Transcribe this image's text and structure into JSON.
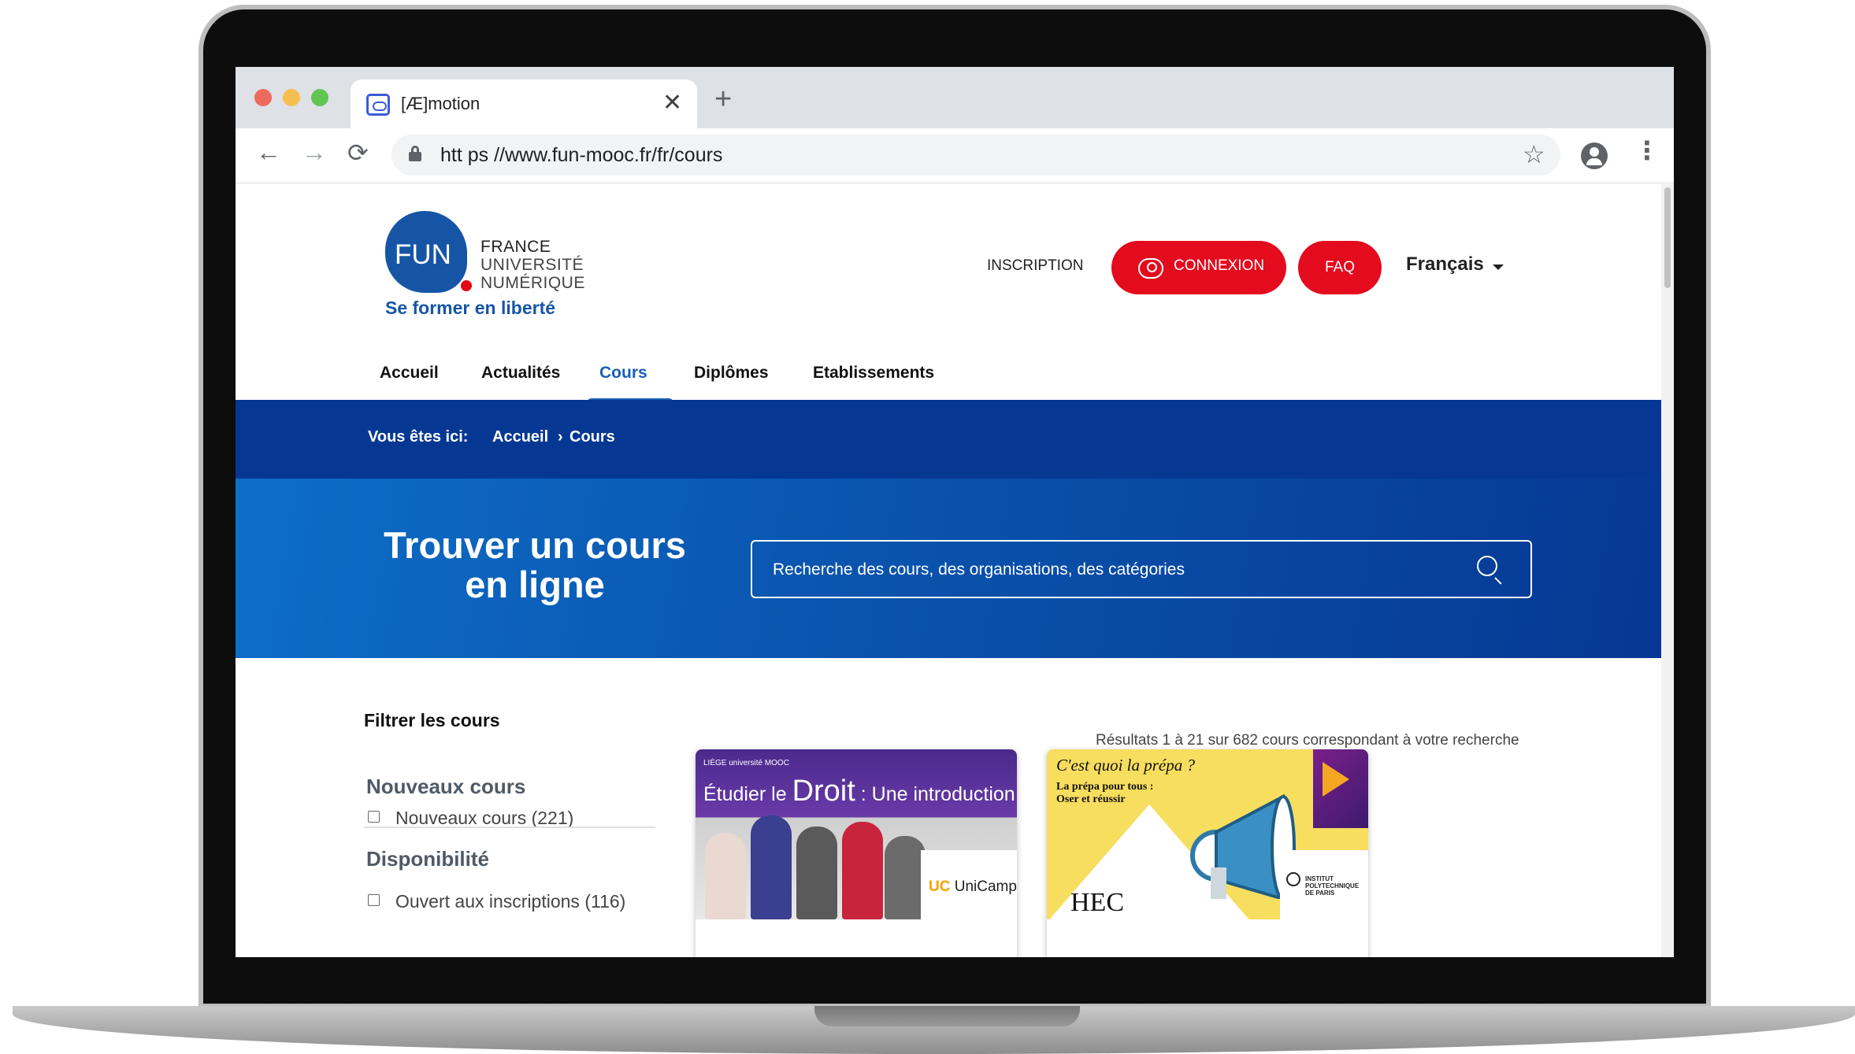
{
  "browser": {
    "tab_title": "[Æ]motion",
    "tab_close": "✕",
    "new_tab": "+",
    "back": "←",
    "forward": "→",
    "reload": "⟳",
    "url": "htt ps //www.fun-mooc.fr/fr/cours",
    "star": "☆",
    "menu": "⋮",
    "icons": [
      "aemotion-favicon",
      "lock-icon",
      "bookmark-star-icon",
      "account-icon",
      "menu-dots-icon"
    ]
  },
  "site": {
    "logo": {
      "fun": "FUN",
      "line1": "FRANCE",
      "line2": "UNIVERSITÉ",
      "line3": "NUMÉRIQUE",
      "tagline": "Se former en liberté"
    },
    "header": {
      "inscription": "INSCRIPTION",
      "connexion": "CONNEXION",
      "faq": "FAQ",
      "language": "Français"
    },
    "nav": {
      "items": [
        "Accueil",
        "Actualités",
        "Cours",
        "Diplômes",
        "Etablissements"
      ],
      "active": "Cours"
    },
    "breadcrumb": {
      "prefix": "Vous êtes ici:",
      "home": "Accueil",
      "sep": "›",
      "current": "Cours"
    },
    "hero": {
      "title_line1": "Trouver un cours",
      "title_line2": "en ligne",
      "search_placeholder": "Recherche des cours, des organisations, des catégories"
    },
    "filters": {
      "title": "Filtrer les cours",
      "facets": [
        {
          "title": "Nouveaux cours",
          "options": [
            {
              "label": "Nouveaux cours (221)",
              "checked": false
            }
          ]
        },
        {
          "title": "Disponibilité",
          "options": [
            {
              "label": "Ouvert aux inscriptions (116)",
              "checked": false
            }
          ]
        }
      ]
    },
    "results": {
      "summary": "Résultats 1 à 21 sur 682 cours correspondant à votre recherche"
    },
    "cards": [
      {
        "image_brand": "LIÈGE université MOOC",
        "image_title_prefix": "Étudier le ",
        "image_title_big": "Droit",
        "image_title_suffix": " : Une introduction",
        "org_prefix": "UC",
        "org_name": " UniCamp"
      },
      {
        "image_question": "C'est quoi la prépa ?",
        "image_sub1": "La prépa pour tous :",
        "image_sub2": "Oser et réussir",
        "image_logo": "HEC",
        "org_name": "INSTITUT POLYTECHNIQUE DE PARIS"
      }
    ]
  },
  "colors": {
    "brand_blue": "#1655a6",
    "brand_red": "#e30b1d",
    "band_blue": "#063893",
    "hero_blue": "#0d6ec7",
    "active_link": "#1a5fb4"
  }
}
